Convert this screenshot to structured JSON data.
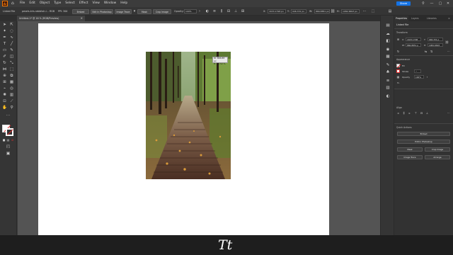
{
  "menubar": {
    "app_logo": "Ai",
    "items": [
      "File",
      "Edit",
      "Object",
      "Type",
      "Select",
      "Effect",
      "View",
      "Window",
      "Help"
    ],
    "share_label": "Share",
    "window_controls": [
      "—",
      "▢",
      "✕"
    ]
  },
  "controlbar": {
    "object_type": "Linked File",
    "filename": "pexels-kris-rabbitsh-l...",
    "color_mode": "RGB",
    "ppi": "PPI: 300",
    "embed_label": "Embed",
    "edit_photoshop_label": "Edit In Photoshop",
    "image_trace_label": "Image Trace",
    "mask_label": "Mask",
    "crop_image_label": "Crop Image",
    "opacity_label": "Opacity:",
    "opacity_value": "100%",
    "x_value": "1633.1798 px",
    "y_value": "946.331 px",
    "w_value": "866.8851 px",
    "h_value": "1082.6693 px"
  },
  "doc_tab": {
    "title": "Untitled-1* @ 16 % (RGB/Preview)",
    "close": "×"
  },
  "canvas": {
    "readout_line1": "W: 866.88 px",
    "readout_line2": "H: 82.52 %"
  },
  "properties": {
    "tabs": [
      "Properties",
      "Layers",
      "Libraries"
    ],
    "object_title": "Linked File",
    "transform_title": "Transform",
    "x_value": "1633.1798",
    "y_value": "946.331 p",
    "w_value": "866.8851 p",
    "h_value": "1082.6693",
    "appearance_title": "Appearance",
    "fill_label": "Fill",
    "stroke_label": "Stroke",
    "opacity_label": "Opacity",
    "opacity_value": "100%",
    "fx_label": "fx.",
    "align_title": "Align",
    "quick_actions_title": "Quick Actions",
    "embed_label": "Embed",
    "edit_photoshop_label": "Edit In Photoshop",
    "mask_label": "Mask",
    "crop_image_label": "Crop Image",
    "image_trace_label": "Image Trace",
    "arrange_label": "Arrange"
  },
  "bottom": {
    "logo_text": "Tt"
  },
  "colors": {
    "accent": "#1473e6",
    "app_orange": "#ff7c00",
    "artboard": "#ffffff",
    "pasteboard": "#545454"
  },
  "icons": [
    "home-icon",
    "selection-tool-icon",
    "direct-selection-icon",
    "pen-tool-icon",
    "type-tool-icon",
    "rectangle-tool-icon",
    "brush-tool-icon",
    "eraser-tool-icon",
    "rotate-tool-icon",
    "scale-tool-icon",
    "width-tool-icon",
    "free-transform-icon",
    "shape-builder-icon",
    "gradient-tool-icon",
    "eyedropper-icon",
    "blend-tool-icon",
    "symbol-sprayer-icon",
    "graph-tool-icon",
    "artboard-tool-icon",
    "slice-tool-icon",
    "hand-tool-icon",
    "zoom-tool-icon"
  ]
}
